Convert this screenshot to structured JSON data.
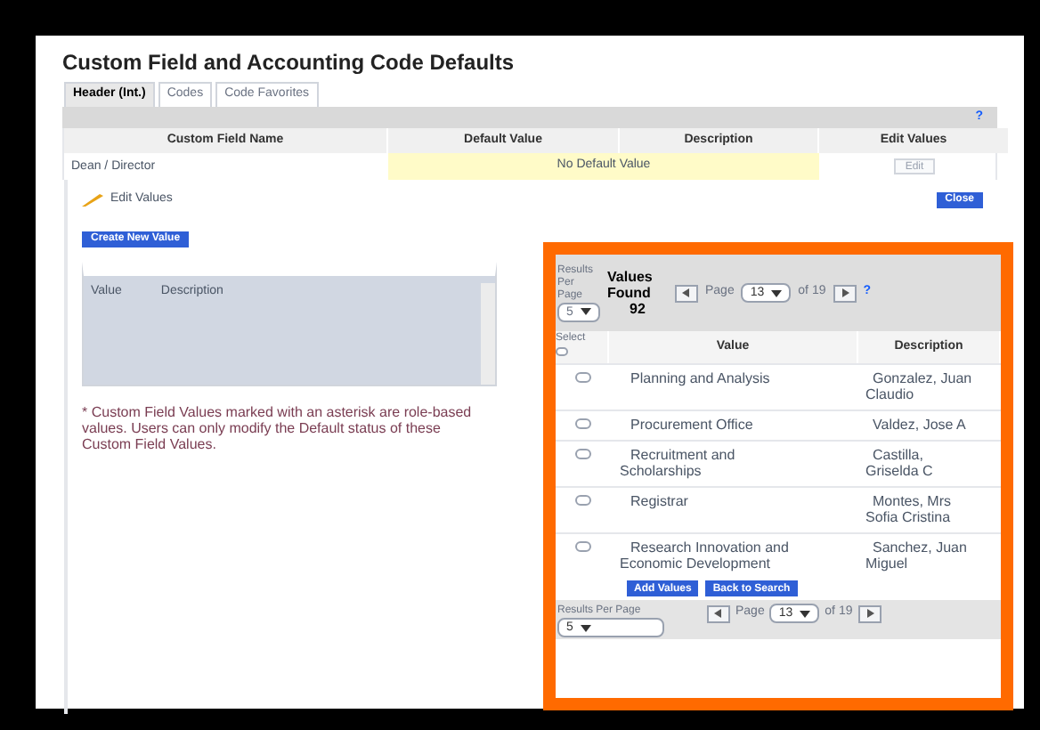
{
  "title": "Custom Field and Accounting Code Defaults",
  "tabs": [
    {
      "label": "Header (Int.)",
      "selected": true
    },
    {
      "label": "Codes",
      "selected": false
    },
    {
      "label": "Code Favorites",
      "selected": false
    }
  ],
  "help": "?",
  "table": {
    "columns": [
      "Custom Field Name",
      "Default Value",
      "Description",
      "Edit Values"
    ],
    "rows": [
      {
        "name": "Dean / Director",
        "default_value": "No Default Value",
        "button": "Edit"
      }
    ]
  },
  "edit_values": {
    "heading": "Edit Values",
    "close": "Close",
    "create": "Create New Value",
    "list_columns": [
      "Value",
      "Description"
    ],
    "note": "* Custom Field Values marked with an asterisk are role-based values. Users can only modify the Default status of these Custom Field Values."
  },
  "popup": {
    "results_per_page": "Results Per Page",
    "per_page_value": "5",
    "found_label": "Values Found",
    "found_count": "92",
    "page_label": "Page",
    "page_value": "13",
    "of_label": "of 19",
    "help": "?",
    "columns": [
      "Select",
      "Value",
      "Description"
    ],
    "select_all_checked": false,
    "rows": [
      {
        "value": "Planning and Analysis",
        "description": "Gonzalez, Juan Claudio",
        "checked": false
      },
      {
        "value": "Procurement Office",
        "description": "Valdez, Jose A",
        "checked": false
      },
      {
        "value": "Recruitment and Scholarships",
        "description": "Castilla, Griselda C",
        "checked": false
      },
      {
        "value": "Registrar",
        "description": "Montes, Mrs Sofia Cristina",
        "checked": false
      },
      {
        "value": "Research Innovation and Economic Development",
        "description": "Sanchez, Juan Miguel",
        "checked": false
      }
    ],
    "buttons": [
      "Add Values",
      "Back to Search"
    ],
    "footer_results": "Results Per Page",
    "footer_per_page": "5",
    "footer_page_label": "Page",
    "footer_page_value": "13",
    "footer_of": "of 19"
  }
}
